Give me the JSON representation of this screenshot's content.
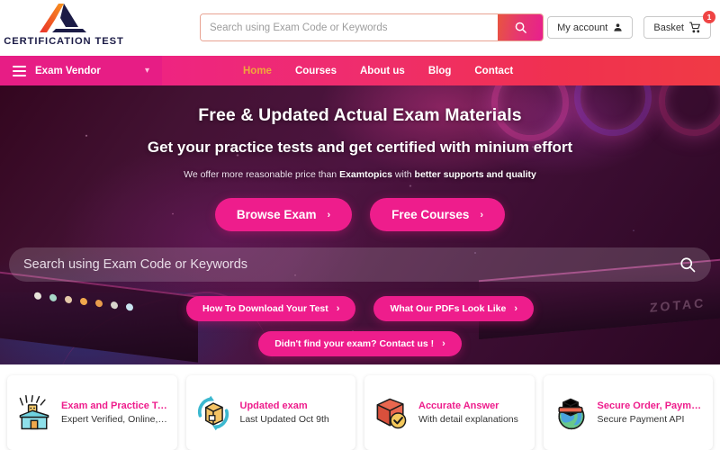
{
  "header": {
    "brand_name": "CERTIFICATION TEST",
    "search": {
      "placeholder": "Search using Exam Code or Keywords",
      "value": "",
      "button_icon": "search-icon"
    },
    "account_label": "My account",
    "basket_label": "Basket",
    "basket_count": "1"
  },
  "nav": {
    "vendor_label": "Exam Vendor",
    "links": [
      {
        "label": "Home",
        "active": true
      },
      {
        "label": "Courses",
        "active": false
      },
      {
        "label": "About us",
        "active": false
      },
      {
        "label": "Blog",
        "active": false
      },
      {
        "label": "Contact",
        "active": false
      }
    ]
  },
  "hero": {
    "title": "Free & Updated Actual Exam Materials",
    "subtitle": "Get your practice tests and get certified with minium effort",
    "note_pre": "We offer more reasonable price than ",
    "note_brand": "Examtopics",
    "note_mid": " with ",
    "note_strong": "better supports and quality",
    "cta_primary": "Browse Exam",
    "cta_secondary": "Free Courses",
    "search_placeholder": "Search using Exam Code or Keywords",
    "search_value": "",
    "chip_download": "How To Download Your Test",
    "chip_pdfs": "What Our PDFs Look Like",
    "chip_contact": "Didn't find your exam? Contact us !",
    "chevron": "›"
  },
  "features": [
    {
      "icon": "gift-box-confetti-icon",
      "title": "Exam and Practice Test",
      "desc": "Expert Verified, Online, Free"
    },
    {
      "icon": "box-refresh-icon",
      "title": "Updated exam",
      "desc": "Last Updated Oct 9th"
    },
    {
      "icon": "box-check-icon",
      "title": "Accurate Answer",
      "desc": "With detail explanations"
    },
    {
      "icon": "globe-package-icon",
      "title": "Secure Order, Payment",
      "desc": "Secure Payment API"
    }
  ],
  "colors": {
    "brand_pink": "#ee1d8c",
    "nav_gradient_start": "#ef2d8a",
    "nav_gradient_end": "#f03a45",
    "nav_active": "#f0a73c",
    "logo_navy": "#1b1b46",
    "logo_orange": "#f26522",
    "badge_red": "#ef4444"
  }
}
